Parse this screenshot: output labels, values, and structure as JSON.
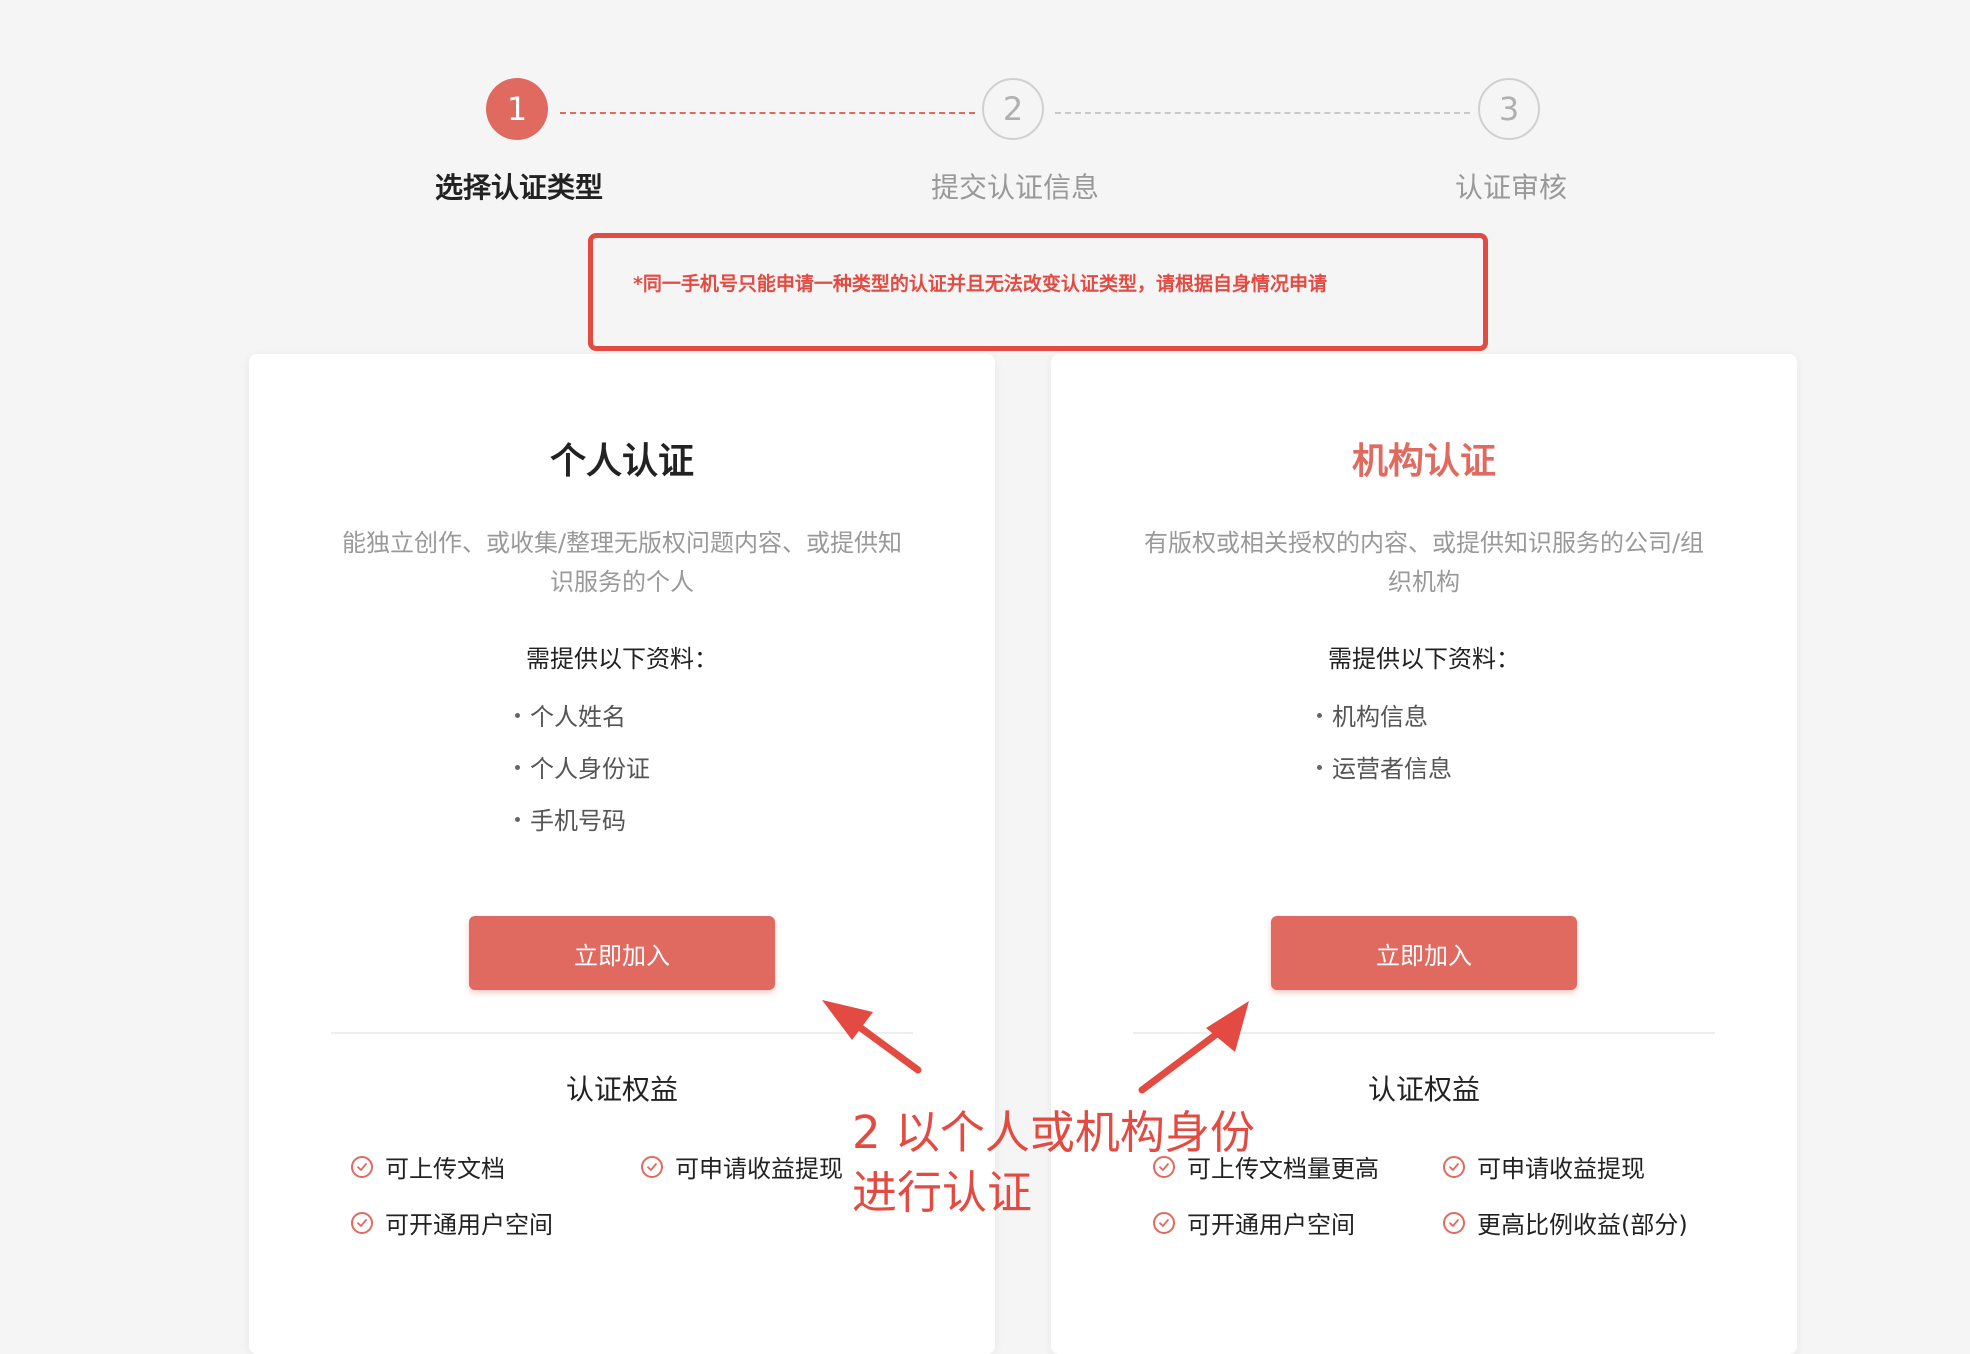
{
  "steps": [
    {
      "number": "1",
      "label": "选择认证类型"
    },
    {
      "number": "2",
      "label": "提交认证信息"
    },
    {
      "number": "3",
      "label": "认证审核"
    }
  ],
  "notice": "*同一手机号只能申请一种类型的认证并且无法改变认证类型，请根据自身情况申请",
  "cards": [
    {
      "title": "个人认证",
      "desc": "能独立创作、或收集/整理无版权问题内容、或提供知识服务的个人",
      "req_title": "需提供以下资料：",
      "requirements": [
        "个人姓名",
        "个人身份证",
        "手机号码"
      ],
      "button": "立即加入",
      "benefit_title": "认证权益",
      "benefits": [
        "可上传文档",
        "可申请收益提现",
        "可开通用户空间"
      ]
    },
    {
      "title": "机构认证",
      "desc": "有版权或相关授权的内容、或提供知识服务的公司/组织机构",
      "req_title": "需提供以下资料：",
      "requirements": [
        "机构信息",
        "运营者信息"
      ],
      "button": "立即加入",
      "benefit_title": "认证权益",
      "benefits": [
        "可上传文档量更高",
        "可申请收益提现",
        "可开通用户空间",
        "更高比例收益(部分)"
      ]
    }
  ],
  "annotation": {
    "line1": "2 以个人或机构身份",
    "line2": "进行认证"
  },
  "colors": {
    "accent": "#e06a60",
    "annotation_red": "#e34b42",
    "background": "#f5f5f5"
  },
  "icons": {
    "benefit": "check-circle-icon"
  }
}
